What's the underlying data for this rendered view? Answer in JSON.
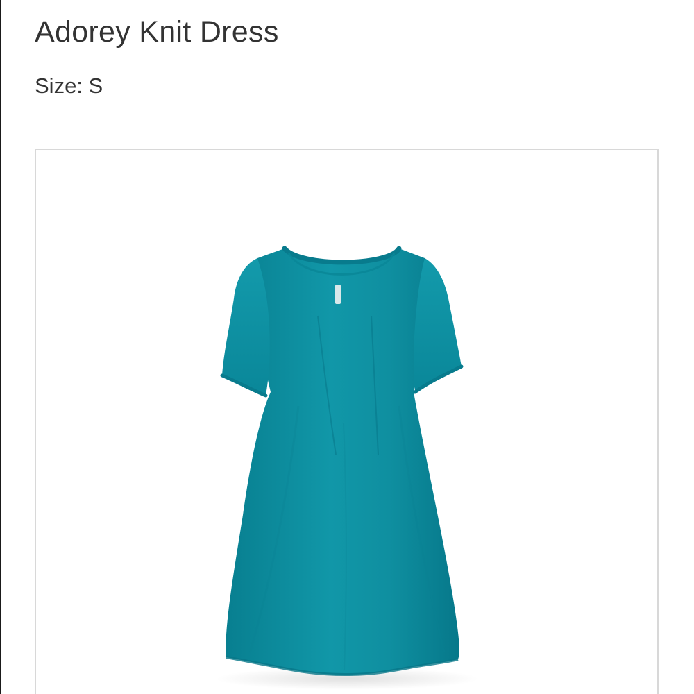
{
  "product": {
    "title": "Adorey Knit Dress",
    "size_label": "Size:",
    "size_value": "S",
    "image": {
      "subject": "dress-image",
      "color": "#0f93a5"
    }
  }
}
